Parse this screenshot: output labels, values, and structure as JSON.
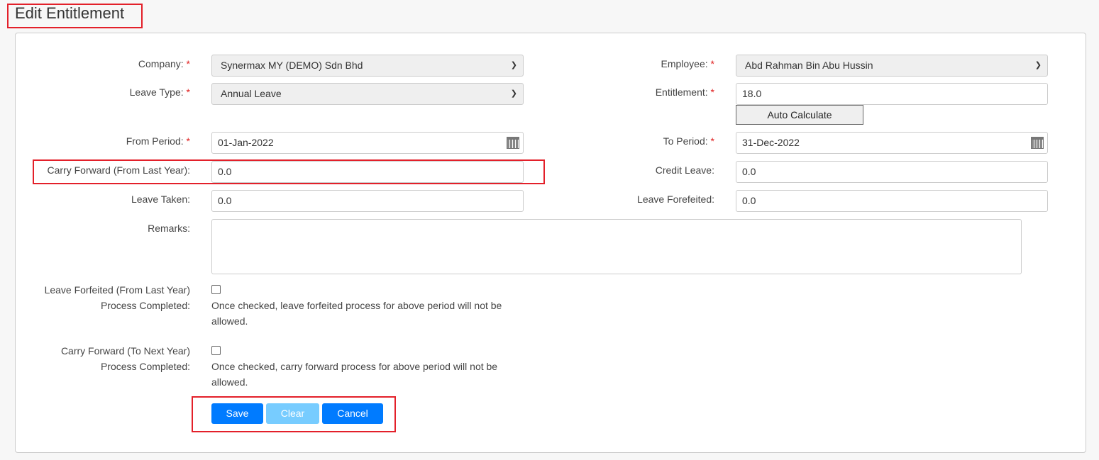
{
  "page_title": "Edit Entitlement",
  "form": {
    "company": {
      "label": "Company:",
      "value": "Synermax MY (DEMO) Sdn Bhd"
    },
    "employee": {
      "label": "Employee:",
      "value": "Abd Rahman Bin Abu Hussin"
    },
    "leave_type": {
      "label": "Leave Type:",
      "value": "Annual Leave"
    },
    "entitlement": {
      "label": "Entitlement:",
      "value": "18.0",
      "auto_calculate": "Auto Calculate"
    },
    "from_period": {
      "label": "From Period:",
      "value": "01-Jan-2022"
    },
    "to_period": {
      "label": "To Period:",
      "value": "31-Dec-2022"
    },
    "carry_forward_from": {
      "label": "Carry Forward (From Last Year):",
      "value": "0.0"
    },
    "credit_leave": {
      "label": "Credit Leave:",
      "value": "0.0"
    },
    "leave_taken": {
      "label": "Leave Taken:",
      "value": "0.0"
    },
    "leave_forfeited": {
      "label": "Leave Forefeited:",
      "value": "0.0"
    },
    "remarks": {
      "label": "Remarks:",
      "value": ""
    },
    "forfeit_process": {
      "label_line1": "Leave Forfeited (From Last Year)",
      "label_line2": "Process Completed:",
      "checked": false,
      "note_line1": "Once checked, leave forfeited process for above period will not be",
      "note_line2": "allowed."
    },
    "carry_process": {
      "label_line1": "Carry Forward (To Next Year)",
      "label_line2": "Process Completed:",
      "checked": false,
      "note_line1": "Once checked, carry forward process for above period will not be",
      "note_line2": "allowed."
    },
    "required_mark": "*"
  },
  "buttons": {
    "save": "Save",
    "clear": "Clear",
    "cancel": "Cancel"
  },
  "colors": {
    "primary": "#007bff",
    "disabled": "#77ccff",
    "highlight": "#e3202a"
  }
}
